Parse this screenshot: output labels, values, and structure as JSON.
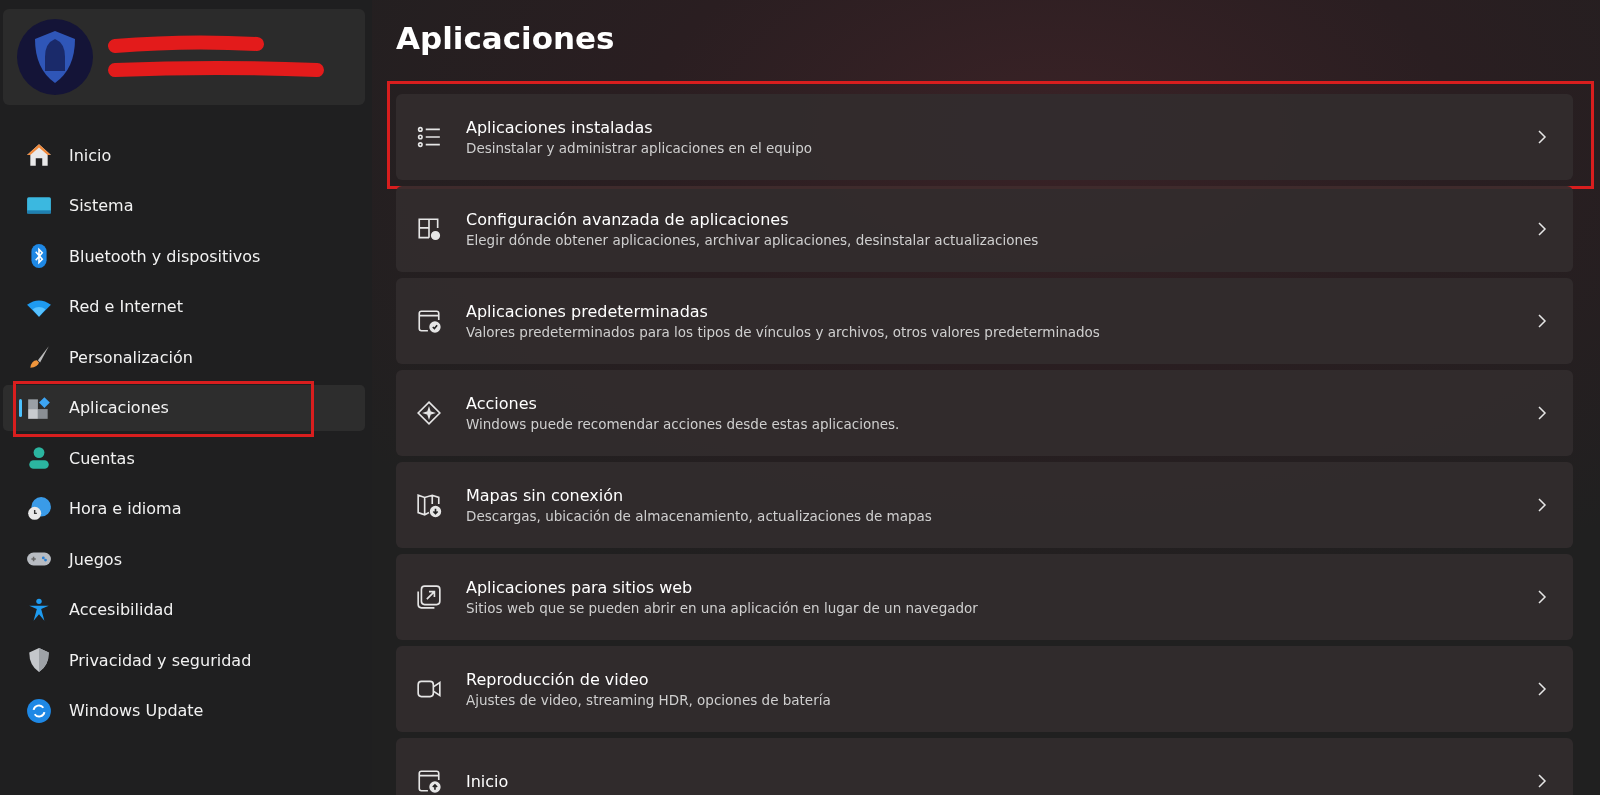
{
  "profile": {
    "redacted": true
  },
  "nav": [
    {
      "label": "Inicio",
      "selected": false,
      "annotated": false
    },
    {
      "label": "Sistema",
      "selected": false,
      "annotated": false
    },
    {
      "label": "Bluetooth y dispositivos",
      "selected": false,
      "annotated": false
    },
    {
      "label": "Red e Internet",
      "selected": false,
      "annotated": false
    },
    {
      "label": "Personalización",
      "selected": false,
      "annotated": false
    },
    {
      "label": "Aplicaciones",
      "selected": true,
      "annotated": true
    },
    {
      "label": "Cuentas",
      "selected": false,
      "annotated": false
    },
    {
      "label": "Hora e idioma",
      "selected": false,
      "annotated": false
    },
    {
      "label": "Juegos",
      "selected": false,
      "annotated": false
    },
    {
      "label": "Accesibilidad",
      "selected": false,
      "annotated": false
    },
    {
      "label": "Privacidad y seguridad",
      "selected": false,
      "annotated": false
    },
    {
      "label": "Windows Update",
      "selected": false,
      "annotated": false
    }
  ],
  "page_title": "Aplicaciones",
  "rows": [
    {
      "title": "Aplicaciones instaladas",
      "subtitle": "Desinstalar y administrar aplicaciones en el equipo",
      "annotated": true
    },
    {
      "title": "Configuración avanzada de aplicaciones",
      "subtitle": "Elegir dónde obtener aplicaciones, archivar aplicaciones, desinstalar actualizaciones",
      "annotated": false
    },
    {
      "title": "Aplicaciones predeterminadas",
      "subtitle": "Valores predeterminados para los tipos de vínculos y archivos, otros valores predeterminados",
      "annotated": false
    },
    {
      "title": "Acciones",
      "subtitle": "Windows puede recomendar acciones desde estas aplicaciones.",
      "annotated": false
    },
    {
      "title": "Mapas sin conexión",
      "subtitle": "Descargas, ubicación de almacenamiento, actualizaciones de mapas",
      "annotated": false
    },
    {
      "title": "Aplicaciones para sitios web",
      "subtitle": "Sitios web que se pueden abrir en una aplicación en lugar de un navegador",
      "annotated": false
    },
    {
      "title": "Reproducción de video",
      "subtitle": "Ajustes de video, streaming HDR, opciones de batería",
      "annotated": false
    },
    {
      "title": "Inicio",
      "annotated": false
    }
  ]
}
